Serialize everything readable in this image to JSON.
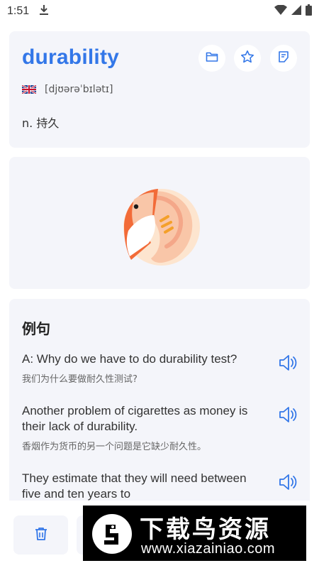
{
  "status_bar": {
    "time": "1:51",
    "icons": [
      "download-icon",
      "wifi-icon",
      "signal-icon",
      "battery-icon"
    ]
  },
  "word": {
    "text": "durability",
    "phonetic": "[djʊərəˈbɪlətɪ]",
    "flag": "uk-flag-icon",
    "definition": "n. 持久",
    "actions": [
      "folder-icon",
      "star-icon",
      "note-icon"
    ]
  },
  "examples": {
    "heading": "例句",
    "items": [
      {
        "en": "A: Why do we have to do durability test?",
        "zh": "我们为什么要做耐久性测试?"
      },
      {
        "en": "Another problem of cigarettes as money is their lack of durability.",
        "zh": "香烟作为货币的另一个问题是它缺少耐久性。"
      },
      {
        "en": "They estimate that they will need between five and ten years to",
        "zh": ""
      }
    ]
  },
  "bottom_bar": {
    "icons": [
      "trash-icon"
    ]
  },
  "watermark": {
    "title": "下载鸟资源",
    "url": "www.xiazainiao.com"
  },
  "colors": {
    "accent": "#3377e8",
    "card_bg": "#f4f5fa",
    "illustration_orange": "#f26b38",
    "illustration_peach": "#fde5cf"
  }
}
